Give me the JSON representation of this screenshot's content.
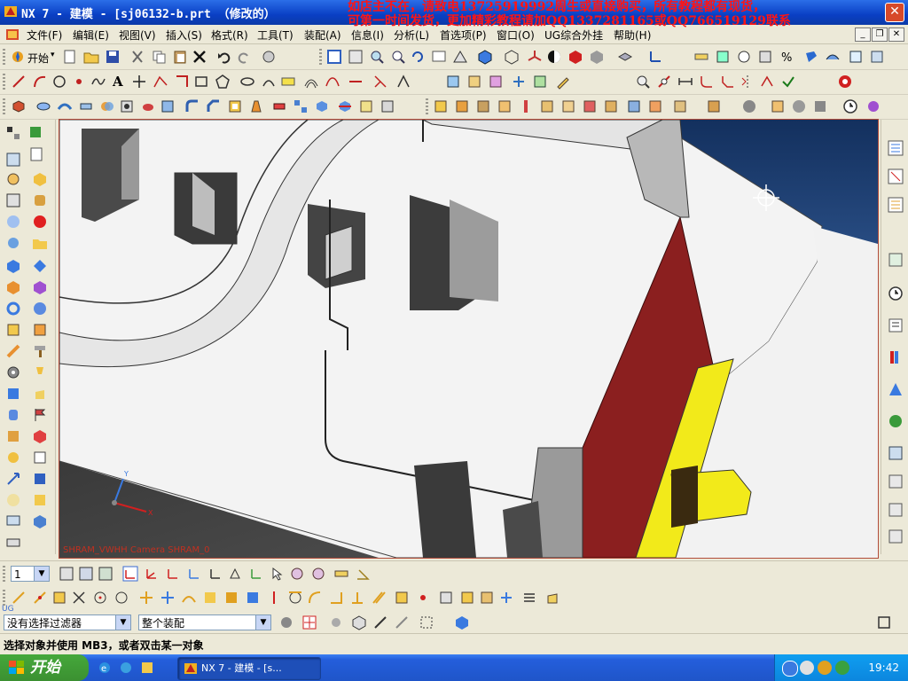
{
  "window": {
    "title": "NX 7 - 建模 - [sj06132-b.prt （修改的）",
    "close_glyph": "✕"
  },
  "banner": {
    "line1": "如店主不在，请致电13725919992周生或直接购买，所有教程都有现货，",
    "line2": "可第一时间发货，更加精彩教程请加QQ1337281165或QQ766519129联系"
  },
  "menu": {
    "items": [
      "文件(F)",
      "编辑(E)",
      "视图(V)",
      "插入(S)",
      "格式(R)",
      "工具(T)",
      "装配(A)",
      "信息(I)",
      "分析(L)",
      "首选项(P)",
      "窗口(O)",
      "UG综合外挂",
      "帮助(H)"
    ]
  },
  "toolbar": {
    "start_label": "开始",
    "text_tool": "A"
  },
  "viewport": {
    "view_label": "SHRAM_VWHH Camera SHRAM_0",
    "colors": {
      "background_top": "#1c3a6b",
      "part_body": "#f3f3f3",
      "red_face": "#8b1f1f",
      "yellow_part": "#f2ea1a"
    }
  },
  "bottom": {
    "layer_value": "1"
  },
  "filters": {
    "selection_filter": "没有选择过滤器",
    "scope": "整个装配"
  },
  "status": {
    "prompt": "选择对象并使用 MB3，或者双击某一对象"
  },
  "taskbar": {
    "start": "开始",
    "window_button": "NX 7 - 建模 - [s...",
    "clock": "19:42"
  }
}
